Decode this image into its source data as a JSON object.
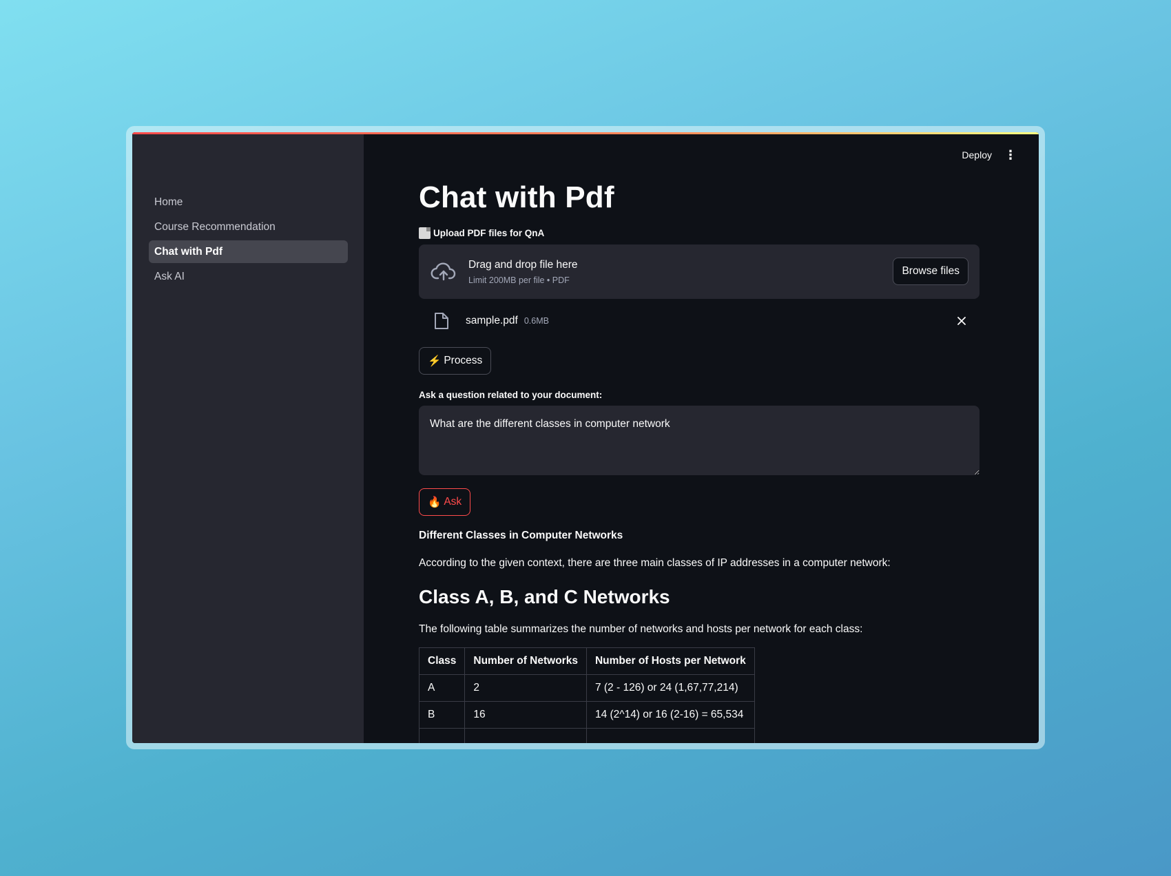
{
  "sidebar": {
    "items": [
      {
        "label": "Home",
        "active": false
      },
      {
        "label": "Course Recommendation",
        "active": false
      },
      {
        "label": "Chat with Pdf",
        "active": true
      },
      {
        "label": "Ask AI",
        "active": false
      }
    ]
  },
  "header": {
    "deploy_label": "Deploy",
    "menu_icon": "kebab-menu-icon"
  },
  "page": {
    "title": "Chat with Pdf"
  },
  "uploader": {
    "label": "Upload PDF files for QnA",
    "label_icon": "document-icon",
    "drop_text": "Drag and drop file here",
    "limit_text": "Limit 200MB per file • PDF",
    "browse_label": "Browse files",
    "upload_icon": "cloud-upload-icon"
  },
  "file": {
    "name": "sample.pdf",
    "size": "0.6MB",
    "icon": "file-icon"
  },
  "process_button": {
    "emoji": "⚡",
    "label": "Process"
  },
  "question": {
    "label": "Ask a question related to your document:",
    "value": "What are the different classes in computer network"
  },
  "ask_button": {
    "emoji": "🔥",
    "label": "Ask"
  },
  "answer": {
    "title": "Different Classes in Computer Networks",
    "intro": "According to the given context, there are three main classes of IP addresses in a computer network:",
    "heading": "Class A, B, and C Networks",
    "table_intro": "The following table summarizes the number of networks and hosts per network for each class:",
    "table": {
      "headers": [
        "Class",
        "Number of Networks",
        "Number of Hosts per Network"
      ],
      "rows": [
        [
          "A",
          "2",
          "7 (2 - 126) or 24 (1,67,77,214)"
        ],
        [
          "B",
          "16",
          "14 (2^14) or 16 (2-16) = 65,534"
        ],
        [
          "",
          "",
          ""
        ]
      ]
    }
  },
  "colors": {
    "app_bg": "#0e1117",
    "sidebar_bg": "#262730",
    "accent": "#ff4b4b",
    "text": "#fafafa"
  }
}
